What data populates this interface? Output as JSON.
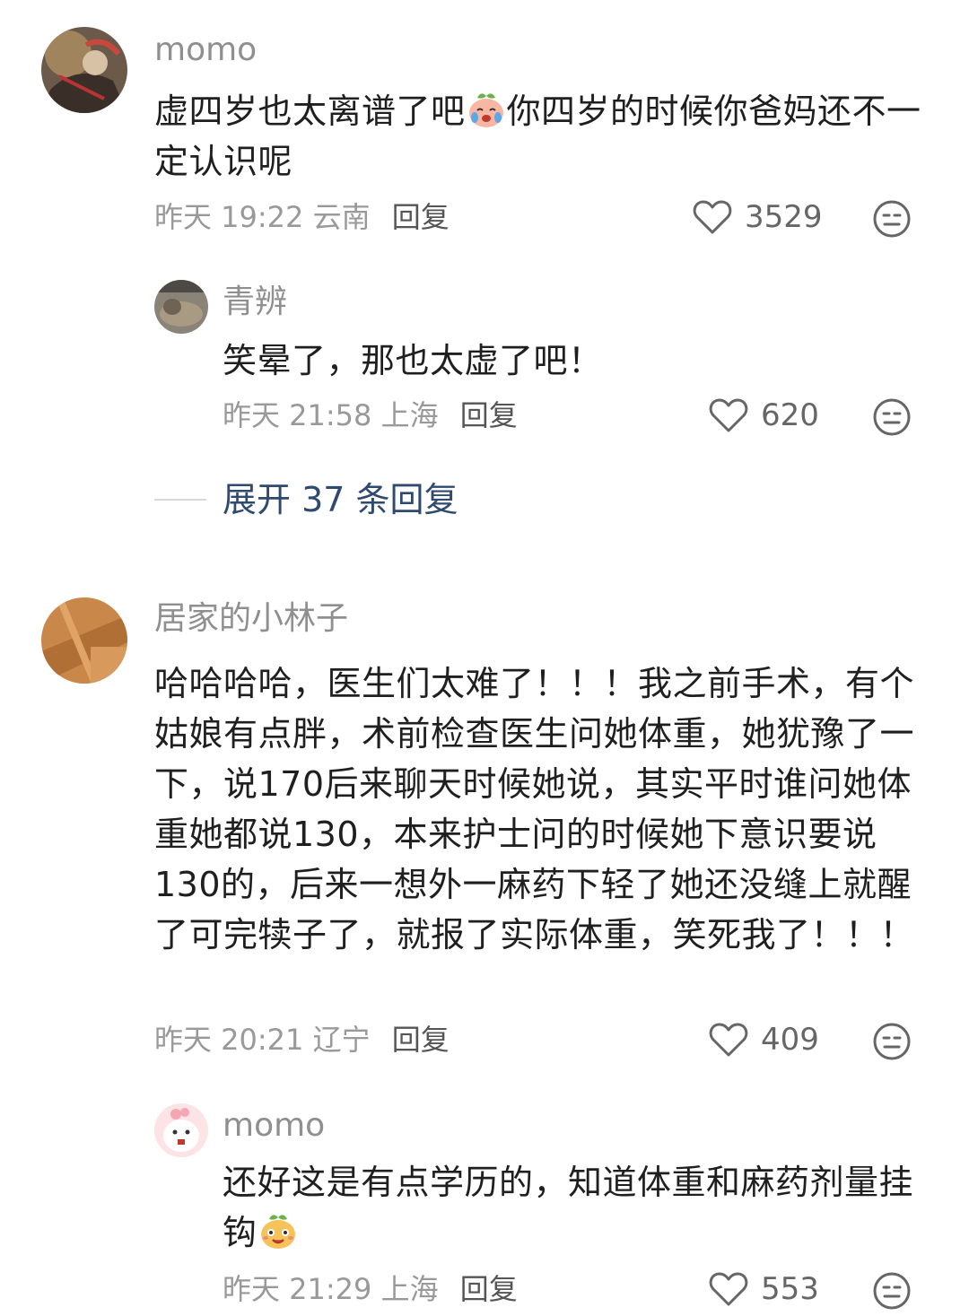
{
  "comments": [
    {
      "user": "momo",
      "text_before": "虚四岁也太离谱了吧",
      "text_after": "你四岁的时候你爸妈还不一定认识呢",
      "emoji": "crying-peach-emoji",
      "time": "昨天 19:22",
      "location": "云南",
      "reply_label": "回复",
      "likes": "3529"
    },
    {
      "user": "青辨",
      "text": "笑晕了，那也太虚了吧！",
      "time": "昨天 21:58",
      "location": "上海",
      "reply_label": "回复",
      "likes": "620"
    },
    {
      "user": "居家的小林子",
      "text": "哈哈哈哈，医生们太难了！！！我之前手术，有个姑娘有点胖，术前检查医生问她体重，她犹豫了一下，说170后来聊天时候她说，其实平时谁问她体重她都说130，本来护士问的时候她下意识要说130的，后来一想外一麻药下轻了她还没缝上就醒了可完犊子了，就报了实际体重，笑死我了！！！",
      "time": "昨天 20:21",
      "location": "辽宁",
      "reply_label": "回复",
      "likes": "409"
    },
    {
      "user": "momo",
      "text": "还好这是有点学历的，知道体重和麻药剂量挂钩",
      "emoji": "smiling-peach-emoji",
      "time": "昨天 21:29",
      "location": "上海",
      "reply_label": "回复",
      "likes": "553"
    }
  ],
  "expand": {
    "label": "展开 37 条回复"
  },
  "icons": {
    "like": "heart-outline-icon",
    "emoji": "emoji-face-icon"
  },
  "colors": {
    "link": "#2f4a70",
    "meta": "#999999",
    "username": "#8f8f8f"
  }
}
